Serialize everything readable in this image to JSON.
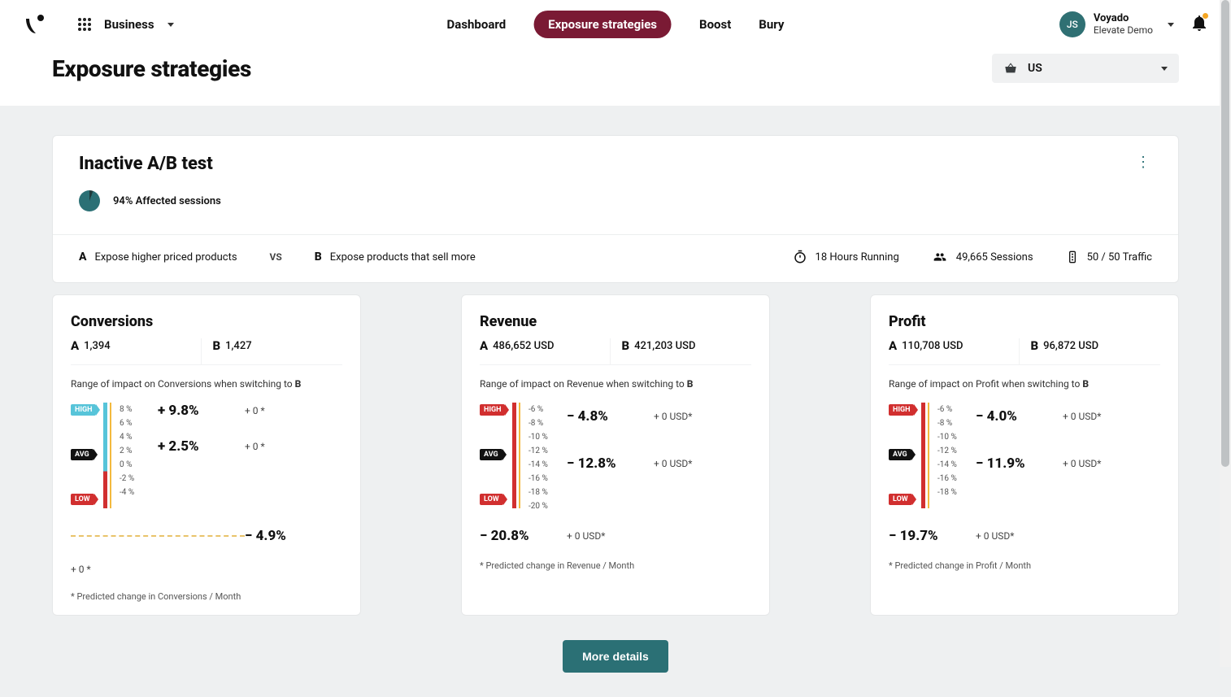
{
  "nav": {
    "business_label": "Business",
    "items": {
      "dashboard": "Dashboard",
      "exposure": "Exposure strategies",
      "boost": "Boost",
      "bury": "Bury"
    }
  },
  "user": {
    "initials": "JS",
    "line1": "Voyado",
    "line2": "Elevate Demo"
  },
  "page_title": "Exposure strategies",
  "market": {
    "label": "US"
  },
  "test": {
    "title": "Inactive A/B test",
    "affected": "94% Affected sessions",
    "a_desc": "Expose higher priced products",
    "vs": "VS",
    "b_desc": "Expose products that sell more",
    "running": "18 Hours Running",
    "sessions": "49,665 Sessions",
    "traffic": "50 / 50 Traffic",
    "letter_a": "A",
    "letter_b": "B"
  },
  "labels": {
    "high": "HIGH",
    "avg": "AVG",
    "low": "LOW"
  },
  "metrics": {
    "conversions": {
      "title": "Conversions",
      "a_val": "1,394",
      "b_val": "1,427",
      "impact_text_prefix": "Range of impact on Conversions when switching to ",
      "impact_text_bold": "B",
      "high_pct": "+ 9.8%",
      "high_pred": "+ 0 *",
      "avg_pct": "+ 2.5%",
      "avg_pred": "+ 0 *",
      "low_pct": "− 4.9%",
      "low_pred": "+ 0 *",
      "footnote": "* Predicted change in Conversions / Month",
      "scale": [
        "8 %",
        "6 %",
        "4 %",
        "2 %",
        "0 %",
        "-2 %",
        "-4 %"
      ]
    },
    "revenue": {
      "title": "Revenue",
      "a_val": "486,652 USD",
      "b_val": "421,203 USD",
      "impact_text_prefix": "Range of impact on Revenue when switching to ",
      "impact_text_bold": "B",
      "high_pct": "− 4.8%",
      "high_pred": "+ 0 USD*",
      "avg_pct": "− 12.8%",
      "avg_pred": "+ 0 USD*",
      "low_pct": "− 20.8%",
      "low_pred": "+ 0 USD*",
      "footnote": "* Predicted change in Revenue / Month",
      "scale": [
        "-6 %",
        "-8 %",
        "-10 %",
        "-12 %",
        "-14 %",
        "-16 %",
        "-18 %",
        "-20 %"
      ]
    },
    "profit": {
      "title": "Profit",
      "a_val": "110,708 USD",
      "b_val": "96,872 USD",
      "impact_text_prefix": "Range of impact on Profit when switching to ",
      "impact_text_bold": "B",
      "high_pct": "− 4.0%",
      "high_pred": "+ 0 USD*",
      "avg_pct": "− 11.9%",
      "avg_pred": "+ 0 USD*",
      "low_pct": "− 19.7%",
      "low_pred": "+ 0 USD*",
      "footnote": "* Predicted change in Profit / Month",
      "scale": [
        "-6 %",
        "-8 %",
        "-10 %",
        "-12 %",
        "-14 %",
        "-16 %",
        "-18 %"
      ]
    }
  },
  "more_details": "More details"
}
